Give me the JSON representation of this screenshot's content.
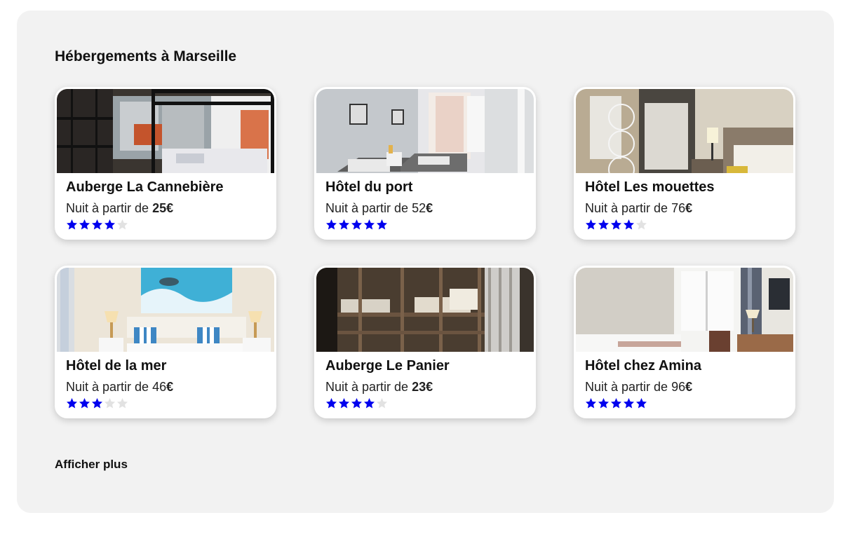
{
  "section": {
    "title": "Hébergements à Marseille",
    "show_more_label": "Afficher plus"
  },
  "colors": {
    "star_active": "#0000ee",
    "star_inactive": "#e2e2e2",
    "panel_bg": "#f2f2f2"
  },
  "price_prefix": "Nuit à partir de ",
  "currency": "€",
  "max_rating": 5,
  "hotels": [
    {
      "name": "Auberge La Cannebière",
      "price": "25",
      "price_bold": true,
      "rating": 4,
      "photo": "dorm bunk beds by window"
    },
    {
      "name": "Hôtel du port",
      "price": "52",
      "price_bold": false,
      "rating": 5,
      "photo": "twin room with window"
    },
    {
      "name": "Hôtel Les mouettes",
      "price": "76",
      "price_bold": false,
      "rating": 4,
      "photo": "room with closet and bed"
    },
    {
      "name": "Hôtel de la mer",
      "price": "46",
      "price_bold": false,
      "rating": 3,
      "photo": "bedroom with sea painting"
    },
    {
      "name": "Auberge Le Panier",
      "price": "23",
      "price_bold": true,
      "rating": 4,
      "photo": "wooden bunk beds"
    },
    {
      "name": "Hôtel chez Amina",
      "price": "96",
      "price_bold": false,
      "rating": 5,
      "photo": "room with tv and window"
    }
  ]
}
